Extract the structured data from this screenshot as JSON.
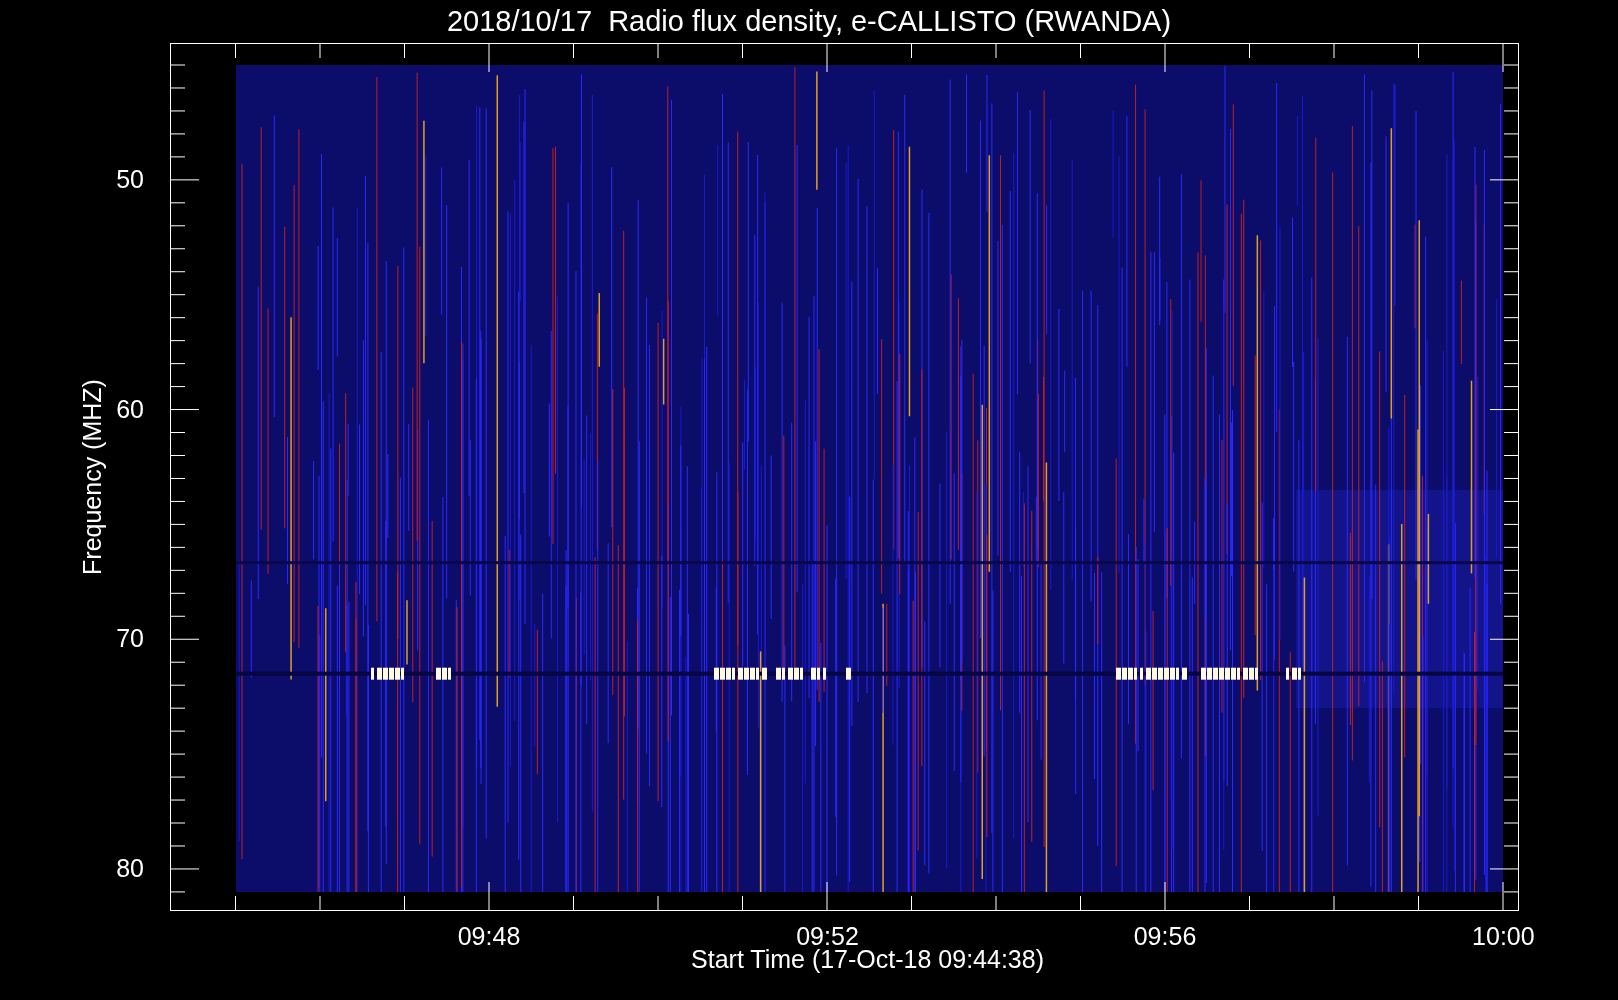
{
  "title": "2018/10/17  Radio flux density, e-CALLISTO (RWANDA)",
  "y_axis": {
    "label": "Frequency (MHZ)",
    "ticks": [
      "50",
      "60",
      "70",
      "80"
    ]
  },
  "x_axis": {
    "label": "Start Time (17-Oct-18 09:44:38)",
    "ticks": [
      "09:48",
      "09:52",
      "09:56",
      "10:00"
    ]
  }
}
